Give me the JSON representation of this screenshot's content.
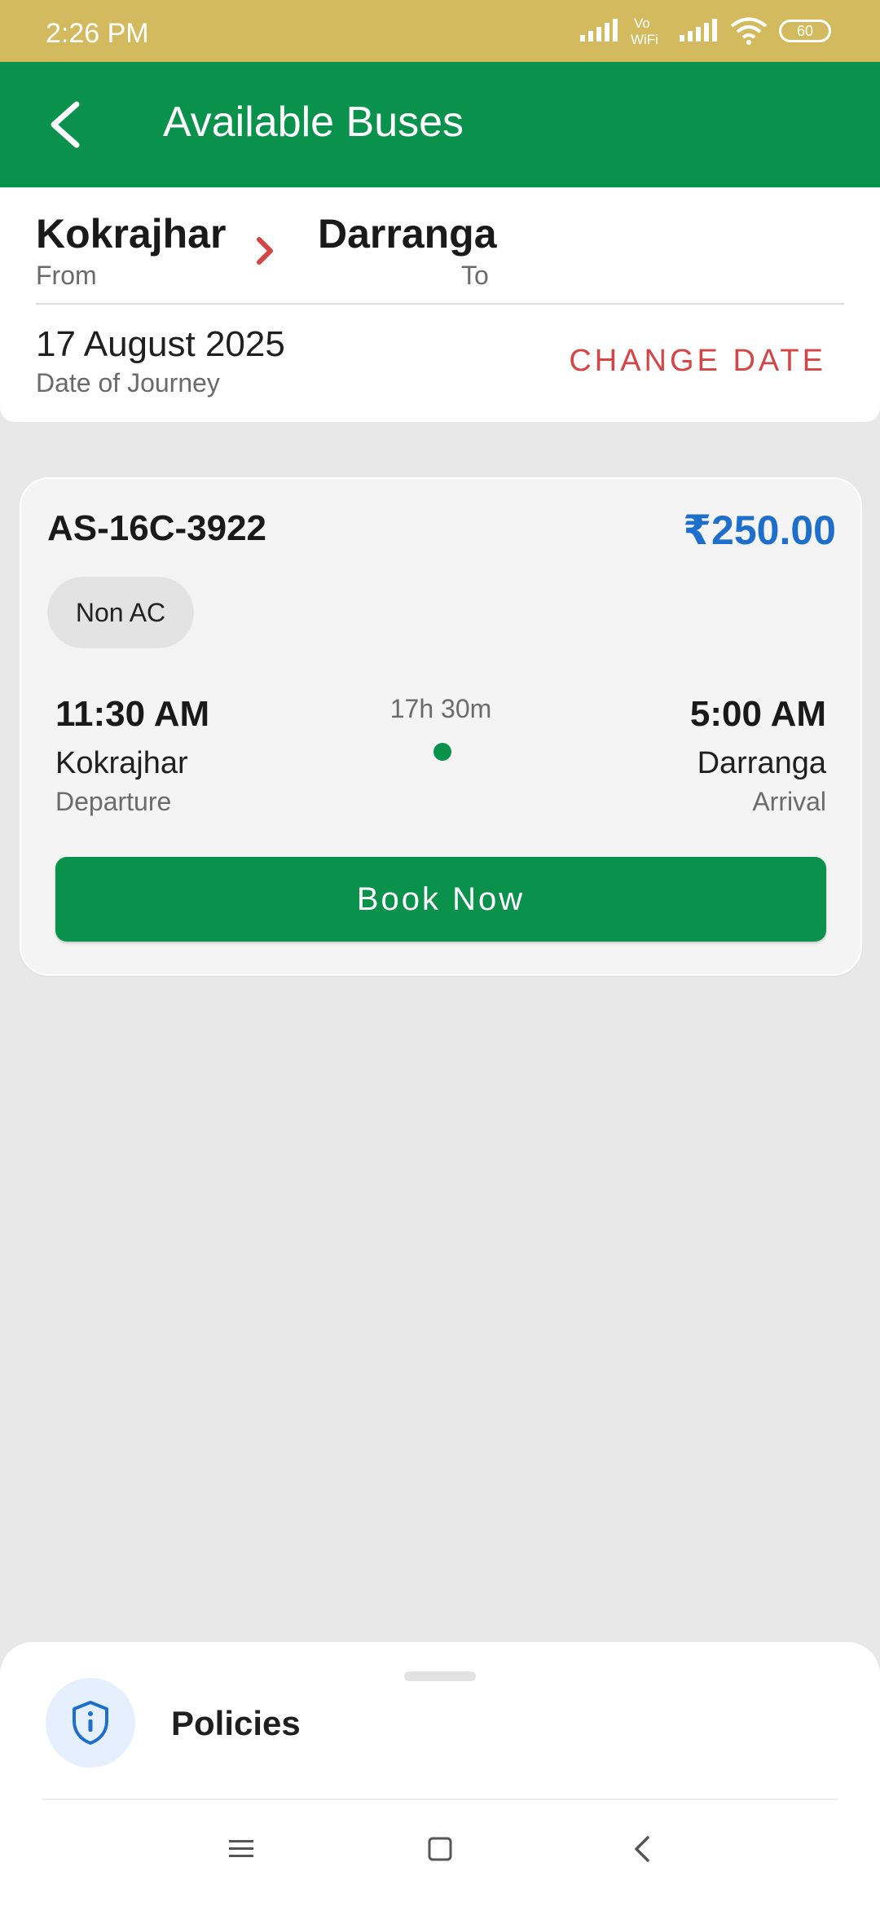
{
  "status_bar": {
    "time": "2:26 PM",
    "battery": "60",
    "icons": [
      "signal-icon",
      "vowifi-icon",
      "signal-icon",
      "wifi-icon",
      "battery-icon"
    ]
  },
  "app_bar": {
    "title": "Available Buses",
    "back_icon": "back-arrow-icon"
  },
  "route": {
    "from_city": "Kokrajhar",
    "from_label": "From",
    "to_city": "Darranga",
    "to_label": "To",
    "date": "17 August 2025",
    "date_label": "Date of Journey",
    "change_date": "CHANGE DATE"
  },
  "bus": {
    "number": "AS-16C-3922",
    "price": "₹250.00",
    "type": "Non AC",
    "departure_time": "11:30 AM",
    "departure_place": "Kokrajhar",
    "departure_label": "Departure",
    "duration": "17h 30m",
    "arrival_time": "5:00 AM",
    "arrival_place": "Darranga",
    "arrival_label": "Arrival",
    "book_label": "Book Now"
  },
  "bottom_sheet": {
    "policies_label": "Policies",
    "policies_icon": "shield-info-icon"
  },
  "nav_bar": {
    "icons": [
      "menu-icon",
      "home-icon",
      "back-icon"
    ]
  },
  "colors": {
    "primary": "#0a914c",
    "status_bar": "#d3ba5e",
    "price": "#1e6fcc",
    "accent_red": "#d64545"
  }
}
